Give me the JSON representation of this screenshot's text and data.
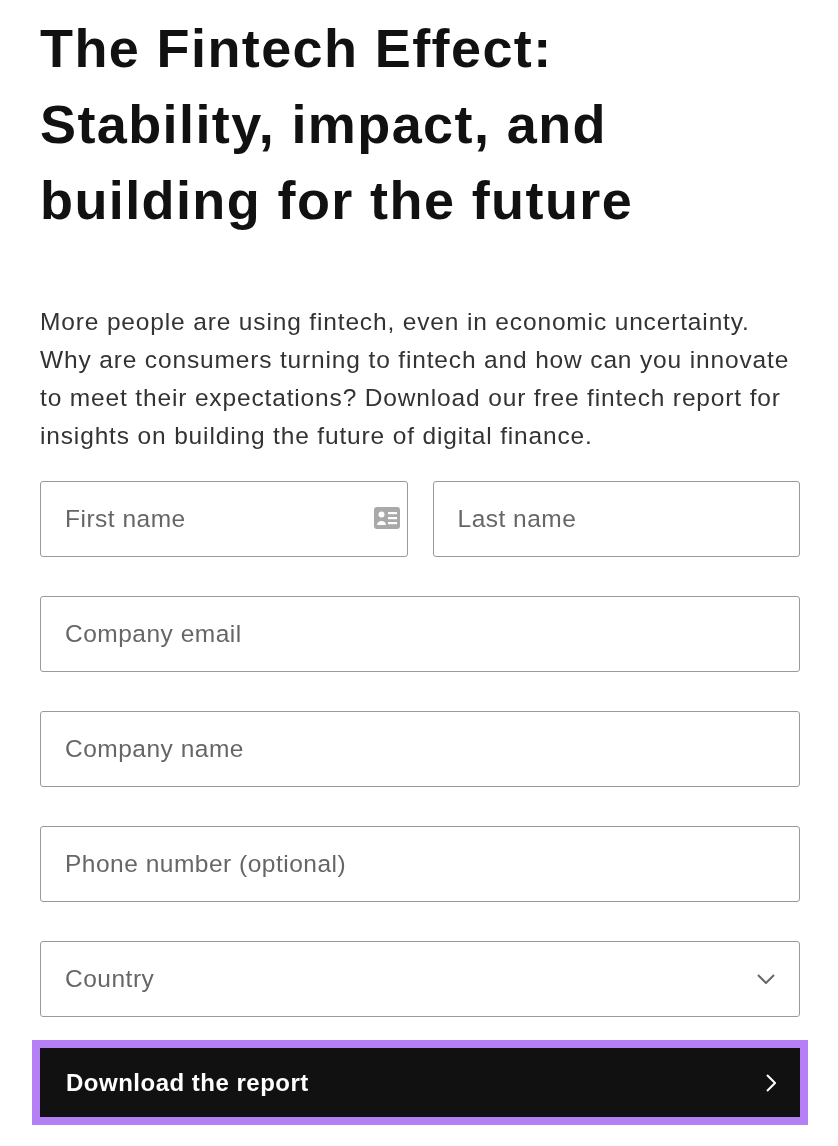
{
  "heading": {
    "title": "The Fintech Effect: Stability, impact, and building for the future"
  },
  "intro": "More people are using fintech, even in economic uncertainty. Why are consumers turning to fintech and how can you innovate to meet their expectations? Download our free fintech report for insights on building the future of digital finance.",
  "form": {
    "rows": [
      [
        {
          "kind": "text",
          "placeholder": "First name",
          "autofill_icon": true
        },
        {
          "kind": "text",
          "placeholder": "Last name"
        }
      ],
      [
        {
          "kind": "text",
          "placeholder": "Company email"
        }
      ],
      [
        {
          "kind": "text",
          "placeholder": "Company name"
        }
      ],
      [
        {
          "kind": "text",
          "placeholder": "Phone number (optional)"
        }
      ],
      [
        {
          "kind": "select",
          "placeholder": "Country"
        }
      ]
    ],
    "submit": {
      "label": "Download the report",
      "focused": true
    }
  }
}
